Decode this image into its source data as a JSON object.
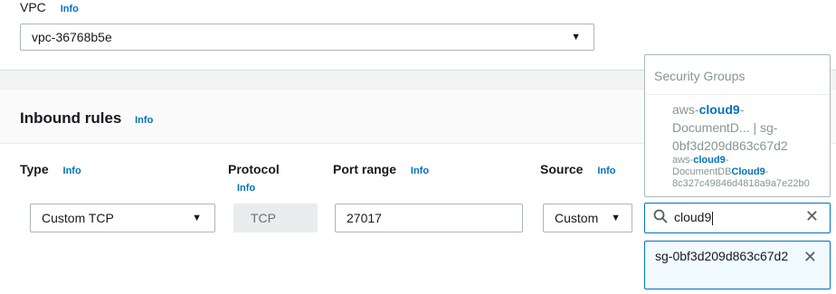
{
  "vpc": {
    "label": "VPC",
    "info": "Info",
    "value": "vpc-36768b5e"
  },
  "inbound": {
    "title": "Inbound rules",
    "info": "Info",
    "columns": {
      "type": {
        "label": "Type",
        "info": "Info"
      },
      "protocol": {
        "label": "Protocol",
        "info": "Info"
      },
      "port_range": {
        "label": "Port range",
        "info": "Info"
      },
      "source": {
        "label": "Source",
        "info": "Info"
      }
    },
    "row": {
      "type": "Custom TCP",
      "protocol": "TCP",
      "port_range": "27017",
      "source": "Custom",
      "search_value": "cloud9",
      "selected_token": "sg-0bf3d209d863c67d2"
    }
  },
  "dropdown": {
    "header": "Security Groups",
    "option": {
      "line1_prefix": "aws-",
      "line1_match": "cloud9",
      "line1_suffix": "-",
      "line2": "DocumentD... | sg-",
      "line3": "0bf3d209d863c67d2",
      "sub1_prefix": "aws-",
      "sub1_match": "cloud9",
      "sub1_suffix": "-",
      "sub2_prefix": "DocumentDB",
      "sub2_match": "Cloud9",
      "sub2_suffix": "-",
      "sub3": "8c327c49846d4818a9a7e22b0"
    }
  },
  "icons": {
    "caret": "caret-down-icon",
    "search": "search-icon",
    "clear": "close-icon"
  },
  "colors": {
    "accent": "#0073bb",
    "token_bg": "#f1faff"
  }
}
